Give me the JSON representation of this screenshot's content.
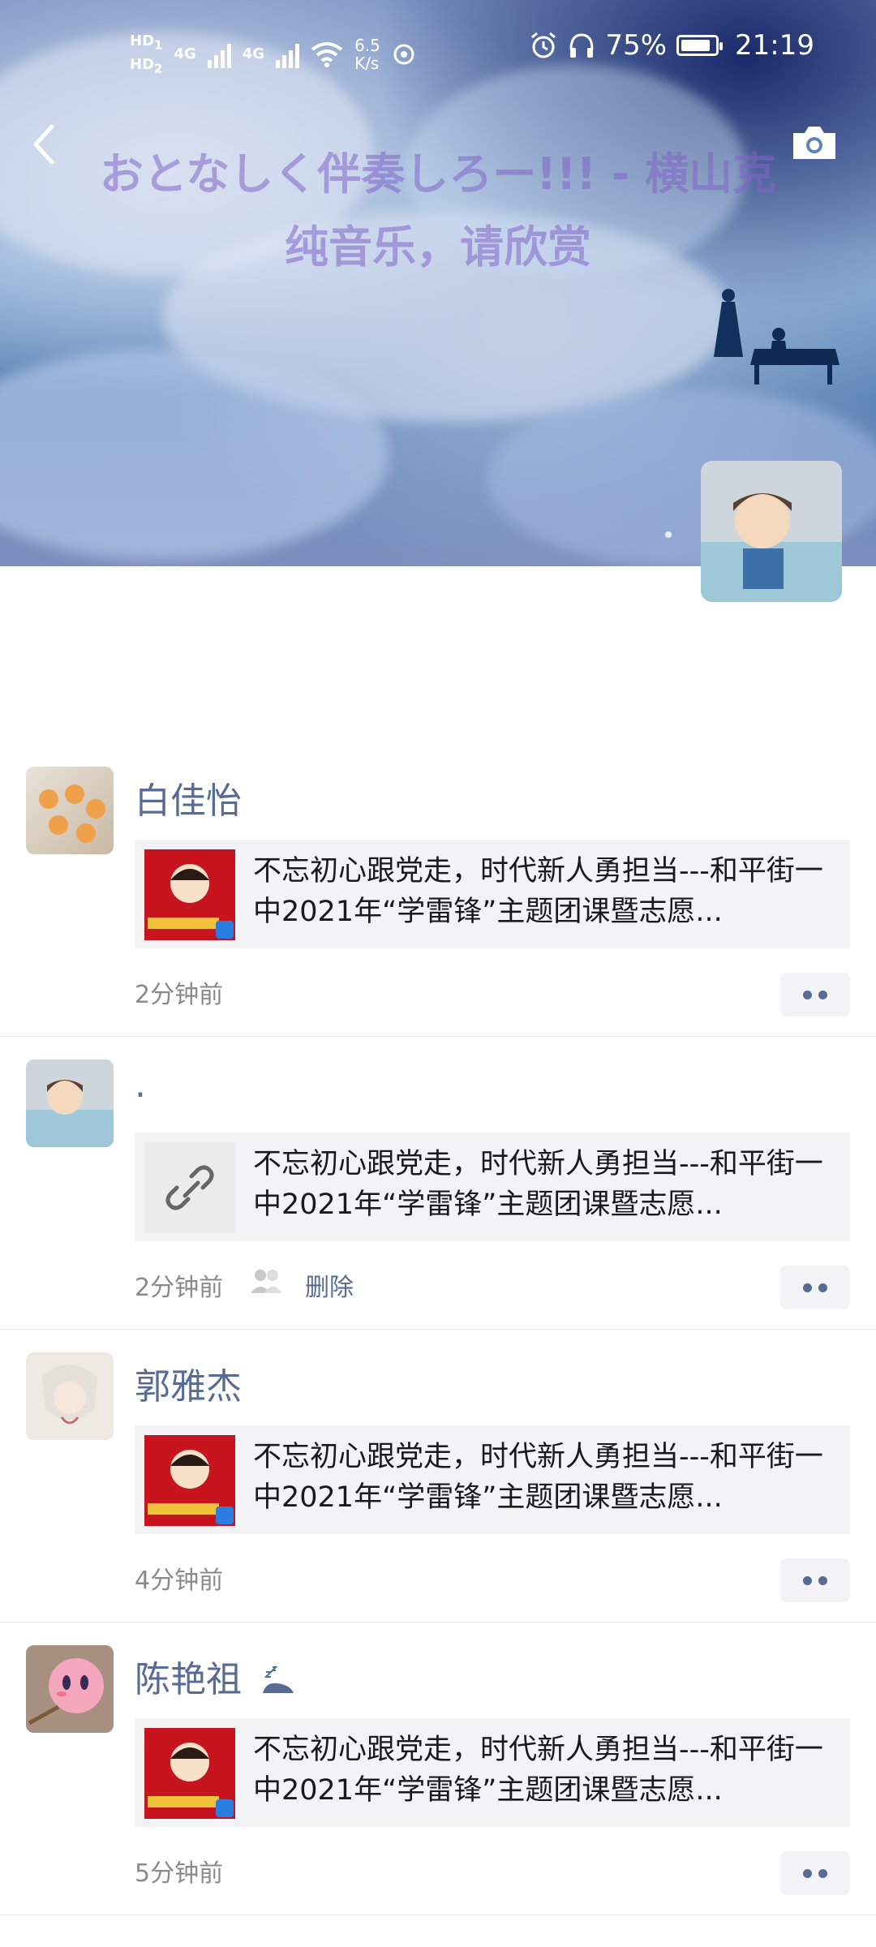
{
  "status_bar": {
    "hd1": "HD",
    "hd1_sub": "1",
    "hd2": "HD",
    "hd2_sub": "2",
    "net1": "4G",
    "net2": "4G",
    "speed_value": "6.5",
    "speed_unit": "K/s",
    "battery_percent": "75%",
    "battery_level": 0.75,
    "time": "21:19"
  },
  "cover": {
    "song_line1": "おとなしく伴奏しろー!!! - 横山克",
    "song_line2": "纯音乐，请欣赏"
  },
  "posts": [
    {
      "name": "白佳怡",
      "share_text": "不忘初心跟党走，时代新人勇担当---和平街一中2021年“学雷锋”主题团课暨志愿...",
      "time": "2分钟前"
    },
    {
      "name": ".",
      "share_text": "不忘初心跟党走，时代新人勇担当---和平街一中2021年“学雷锋”主题团课暨志愿...",
      "time": "2分钟前",
      "delete_label": "删除"
    },
    {
      "name": "郭雅杰",
      "share_text": "不忘初心跟党走，时代新人勇担当---和平街一中2021年“学雷锋”主题团课暨志愿...",
      "time": "4分钟前"
    },
    {
      "name": "陈艳祖",
      "share_text": "不忘初心跟党走，时代新人勇担当---和平街一中2021年“学雷锋”主题团课暨志愿...",
      "time": "5分钟前"
    }
  ],
  "colors": {
    "name_link": "#576b95",
    "accent_red": "#c8141e"
  },
  "icons": [
    "back-arrow-icon",
    "camera-icon",
    "alarm-icon",
    "headphones-icon",
    "wifi-icon",
    "link-icon",
    "privacy-icon",
    "more-dots-icon",
    "sleep-icon"
  ]
}
